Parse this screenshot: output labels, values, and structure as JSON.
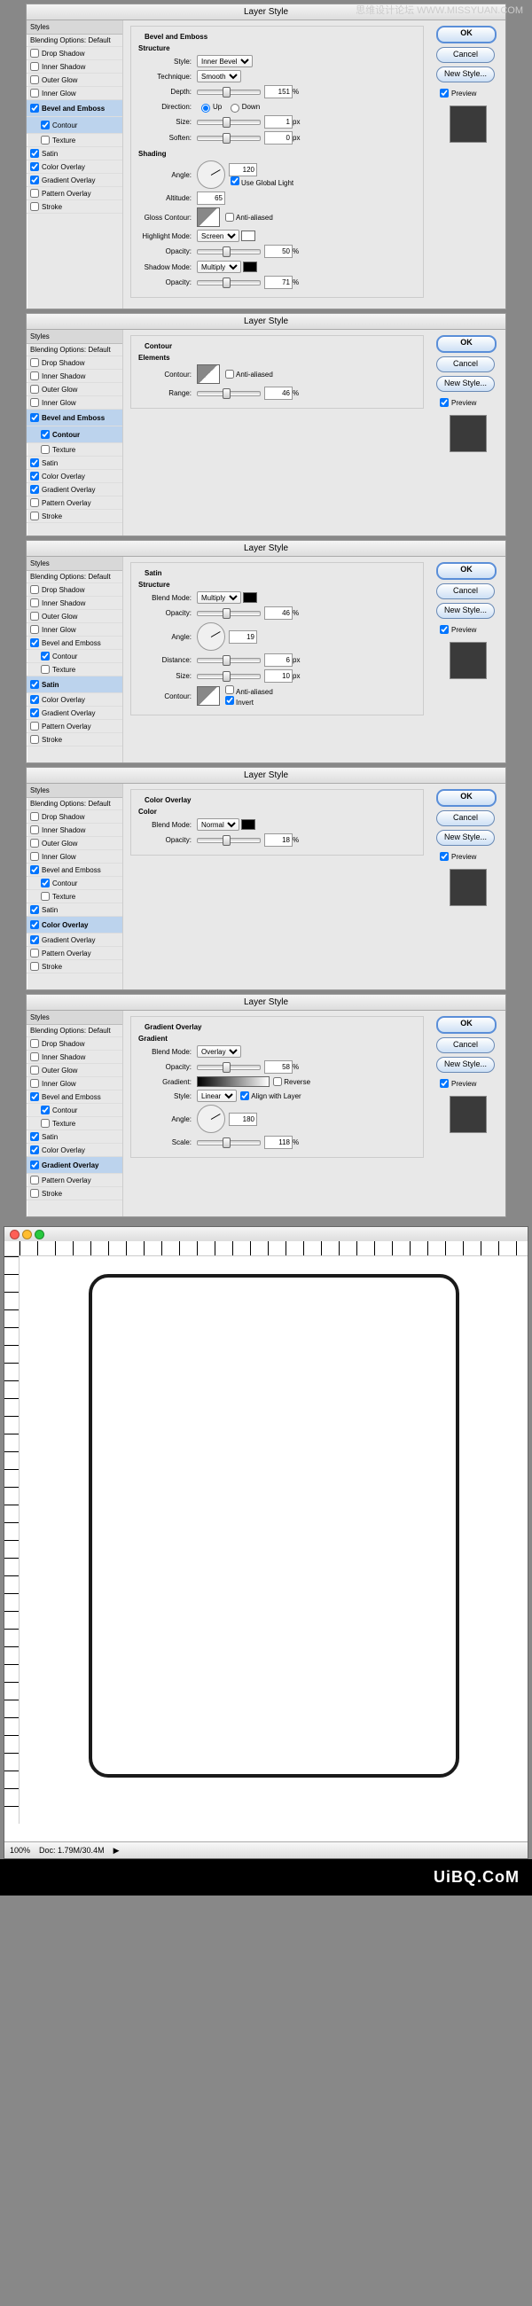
{
  "watermark_top": "思维设计论坛 WWW.MISSYUAN.COM",
  "dialogs": [
    {
      "title": "Layer Style",
      "selected": "Bevel and Emboss",
      "panel": "bevel"
    },
    {
      "title": "Layer Style",
      "selected": "Contour",
      "panel": "contour"
    },
    {
      "title": "Layer Style",
      "selected": "Satin",
      "panel": "satin"
    },
    {
      "title": "Layer Style",
      "selected": "Color Overlay",
      "panel": "coloroverlay"
    },
    {
      "title": "Layer Style",
      "selected": "Gradient Overlay",
      "panel": "gradientoverlay"
    }
  ],
  "sidebar": {
    "header": "Styles",
    "blending": "Blending Options: Default",
    "items": [
      {
        "label": "Drop Shadow",
        "checked": false
      },
      {
        "label": "Inner Shadow",
        "checked": false
      },
      {
        "label": "Outer Glow",
        "checked": false
      },
      {
        "label": "Inner Glow",
        "checked": false
      },
      {
        "label": "Bevel and Emboss",
        "checked": true
      },
      {
        "label": "Contour",
        "checked": true,
        "indent": true
      },
      {
        "label": "Texture",
        "checked": false,
        "indent": true
      },
      {
        "label": "Satin",
        "checked": true
      },
      {
        "label": "Color Overlay",
        "checked": true
      },
      {
        "label": "Gradient Overlay",
        "checked": true
      },
      {
        "label": "Pattern Overlay",
        "checked": false
      },
      {
        "label": "Stroke",
        "checked": false
      }
    ]
  },
  "buttons": {
    "ok": "OK",
    "cancel": "Cancel",
    "newstyle": "New Style...",
    "preview": "Preview"
  },
  "bevel": {
    "group1": "Bevel and Emboss",
    "sub1": "Structure",
    "style_lbl": "Style:",
    "style_val": "Inner Bevel",
    "tech_lbl": "Technique:",
    "tech_val": "Smooth",
    "depth_lbl": "Depth:",
    "depth_val": "151",
    "depth_unit": "%",
    "dir_lbl": "Direction:",
    "up": "Up",
    "down": "Down",
    "size_lbl": "Size:",
    "size_val": "1",
    "size_unit": "px",
    "soft_lbl": "Soften:",
    "soft_val": "0",
    "soft_unit": "px",
    "sub2": "Shading",
    "angle_lbl": "Angle:",
    "angle_val": "120",
    "global": "Use Global Light",
    "alt_lbl": "Altitude:",
    "alt_val": "65",
    "gloss_lbl": "Gloss Contour:",
    "aa": "Anti-aliased",
    "hl_lbl": "Highlight Mode:",
    "hl_val": "Screen",
    "hl_op_lbl": "Opacity:",
    "hl_op_val": "50",
    "pct": "%",
    "sh_lbl": "Shadow Mode:",
    "sh_val": "Multiply",
    "sh_op_lbl": "Opacity:",
    "sh_op_val": "71"
  },
  "contour": {
    "group": "Contour",
    "sub": "Elements",
    "ct_lbl": "Contour:",
    "aa": "Anti-aliased",
    "range_lbl": "Range:",
    "range_val": "46",
    "pct": "%"
  },
  "satin": {
    "group": "Satin",
    "sub": "Structure",
    "bm_lbl": "Blend Mode:",
    "bm_val": "Multiply",
    "op_lbl": "Opacity:",
    "op_val": "46",
    "pct": "%",
    "angle_lbl": "Angle:",
    "angle_val": "19",
    "dist_lbl": "Distance:",
    "dist_val": "6",
    "px": "px",
    "size_lbl": "Size:",
    "size_val": "10",
    "ct_lbl": "Contour:",
    "aa": "Anti-aliased",
    "inv": "Invert"
  },
  "coloroverlay": {
    "group": "Color Overlay",
    "sub": "Color",
    "bm_lbl": "Blend Mode:",
    "bm_val": "Normal",
    "op_lbl": "Opacity:",
    "op_val": "18",
    "pct": "%"
  },
  "gradientoverlay": {
    "group": "Gradient Overlay",
    "sub": "Gradient",
    "bm_lbl": "Blend Mode:",
    "bm_val": "Overlay",
    "op_lbl": "Opacity:",
    "op_val": "58",
    "pct": "%",
    "grad_lbl": "Gradient:",
    "rev": "Reverse",
    "style_lbl": "Style:",
    "style_val": "Linear",
    "align": "Align with Layer",
    "angle_lbl": "Angle:",
    "angle_val": "180",
    "scale_lbl": "Scale:",
    "scale_val": "118"
  },
  "canvas": {
    "zoom": "100%",
    "doc": "Doc: 1.79M/30.4M"
  },
  "footer": "UiBQ.CoM"
}
